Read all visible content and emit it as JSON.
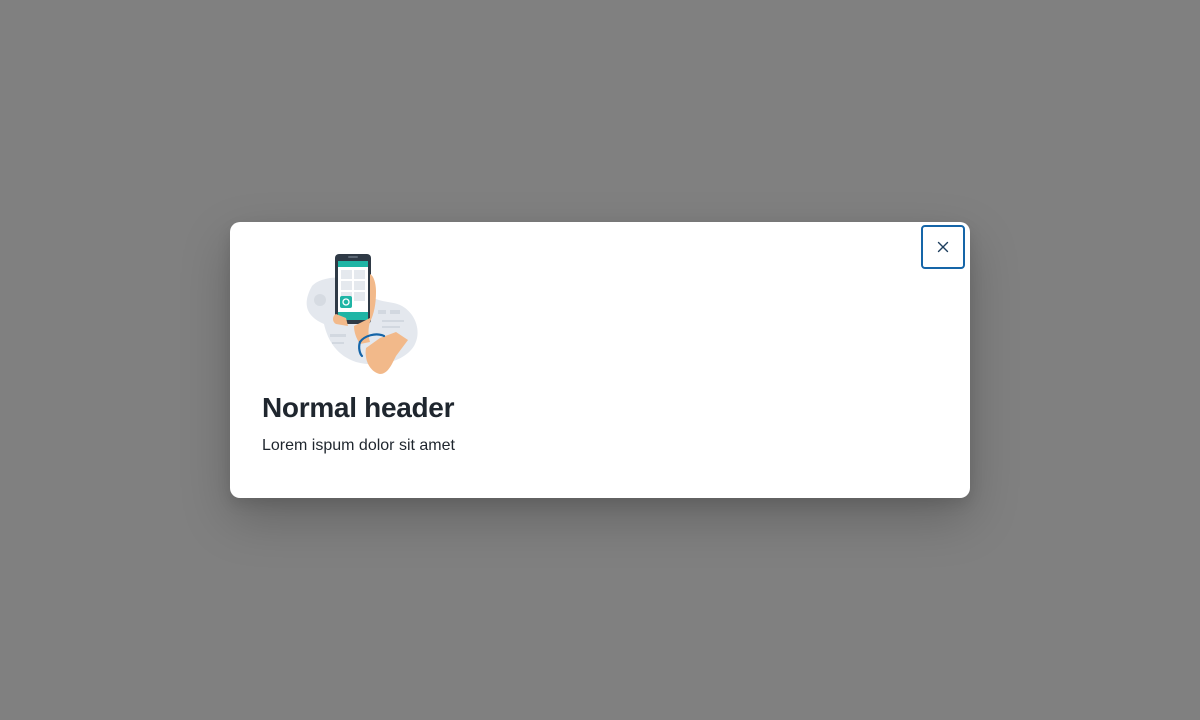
{
  "modal": {
    "title": "Normal header",
    "body": "Lorem ispum dolor sit amet",
    "close_icon": "close-icon",
    "illustration": "hand-holding-phone-illustration"
  },
  "colors": {
    "overlay": "#808080",
    "close_border": "#1565a8",
    "title_text": "#1f262e",
    "accent_teal": "#1fb5a5"
  }
}
